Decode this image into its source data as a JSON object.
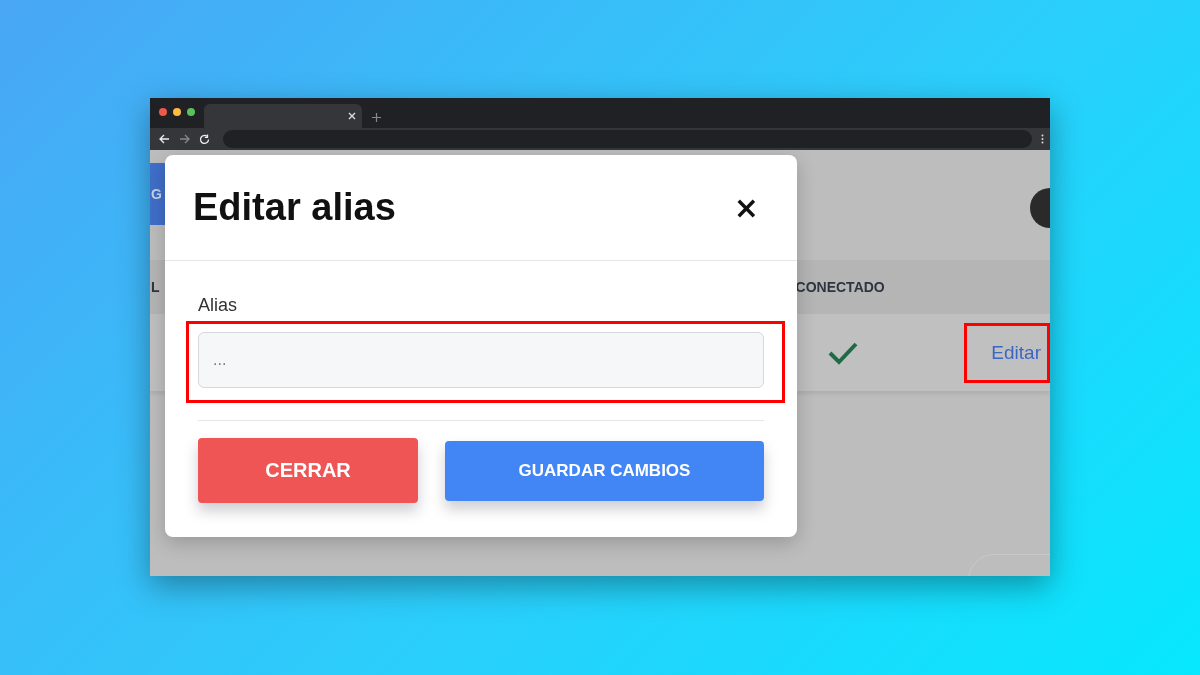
{
  "page": {
    "top_button": "G",
    "columns": [
      "L",
      "CONECTADO"
    ],
    "row": {
      "connected": true,
      "action": "Editar",
      "highlighted": true
    }
  },
  "modal": {
    "title": "Editar alias",
    "close": "×",
    "field": {
      "label": "Alias",
      "placeholder": "...",
      "highlighted": true
    },
    "buttons": [
      {
        "label": "CERRAR",
        "kind": "cancel"
      },
      {
        "label": "GUARDAR CAMBIOS",
        "kind": "primary"
      }
    ]
  }
}
